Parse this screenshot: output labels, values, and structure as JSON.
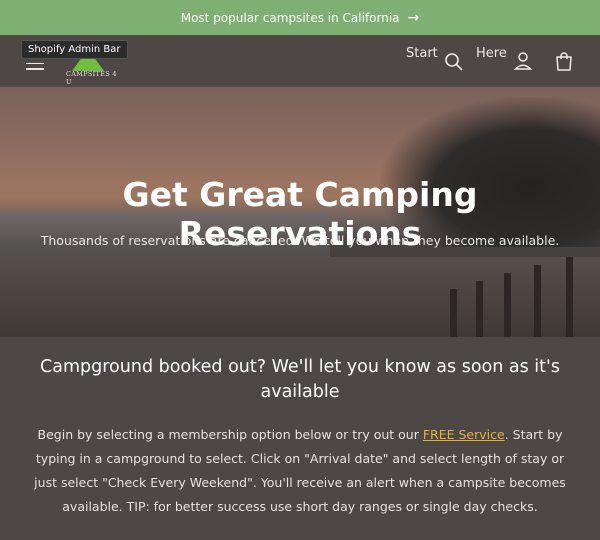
{
  "announcement": {
    "text": "Most popular campsites in California",
    "arrow": "→"
  },
  "header": {
    "admin_bar": "Shopify Admin Bar",
    "logo_text": "CAMPSITES 4 U",
    "start_label": "Start",
    "here_label": "Here"
  },
  "hero": {
    "title": "Get Great Camping Reservations",
    "subtitle": "Thousands of reservations are cancelled. We tell you when they become available."
  },
  "content": {
    "heading": "Campground booked out? We'll let you know as soon as it's available",
    "para_before": "Begin by selecting a membership option below or try out our ",
    "link_text": "FREE Service",
    "para_after": ". Start by typing in a campground to select. Click on \"Arrival date\" and select length of stay or just select \"Check Every Weekend\". You'll receive an alert when a campsite becomes available. TIP: for better success use short day ranges or single day checks."
  },
  "colors": {
    "announce_bg": "#7fb073",
    "page_bg": "#4d4745",
    "link": "#e2b23c"
  },
  "icons": [
    "menu-icon",
    "search-icon",
    "account-icon",
    "cart-icon"
  ]
}
